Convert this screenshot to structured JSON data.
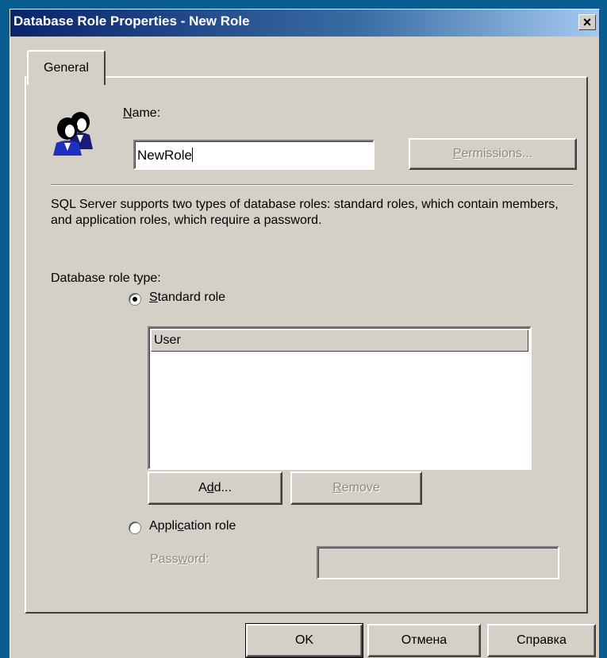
{
  "window": {
    "title": "Database Role Properties - New Role",
    "close_glyph": "×"
  },
  "tabs": [
    {
      "label": "General",
      "active": true
    }
  ],
  "general": {
    "icon": "roles-icon",
    "name_label_ul": "N",
    "name_label_rest": "ame:",
    "name_value": "NewRole",
    "permissions_label_ul": "P",
    "permissions_label_rest": "ermissions...",
    "description": "SQL Server supports two types of database roles: standard roles, which contain members, and application roles, which require a password.",
    "role_type_label": "Database role type:",
    "standard_role": {
      "label_ul": "S",
      "label_rest": "tandard role",
      "selected": true,
      "column_header": "User",
      "members": []
    },
    "add_button": {
      "pre": "A",
      "ul": "d",
      "post": "d..."
    },
    "remove_button": {
      "ul": "R",
      "post": "emove"
    },
    "application_role": {
      "pre": "Appli",
      "ul": "c",
      "post": "ation role",
      "selected": false
    },
    "password_label": {
      "pre": "Pass",
      "ul": "w",
      "post": "ord:"
    },
    "password_value": ""
  },
  "buttons": {
    "ok": "OK",
    "cancel": "Отмена",
    "help": "Справка"
  },
  "colors": {
    "desktop": "#0a5d90",
    "dialog_face": "#d4d0c8",
    "titlebar_start": "#0a246a",
    "titlebar_end": "#a6caf0",
    "disabled_text": "#8c8a85"
  }
}
